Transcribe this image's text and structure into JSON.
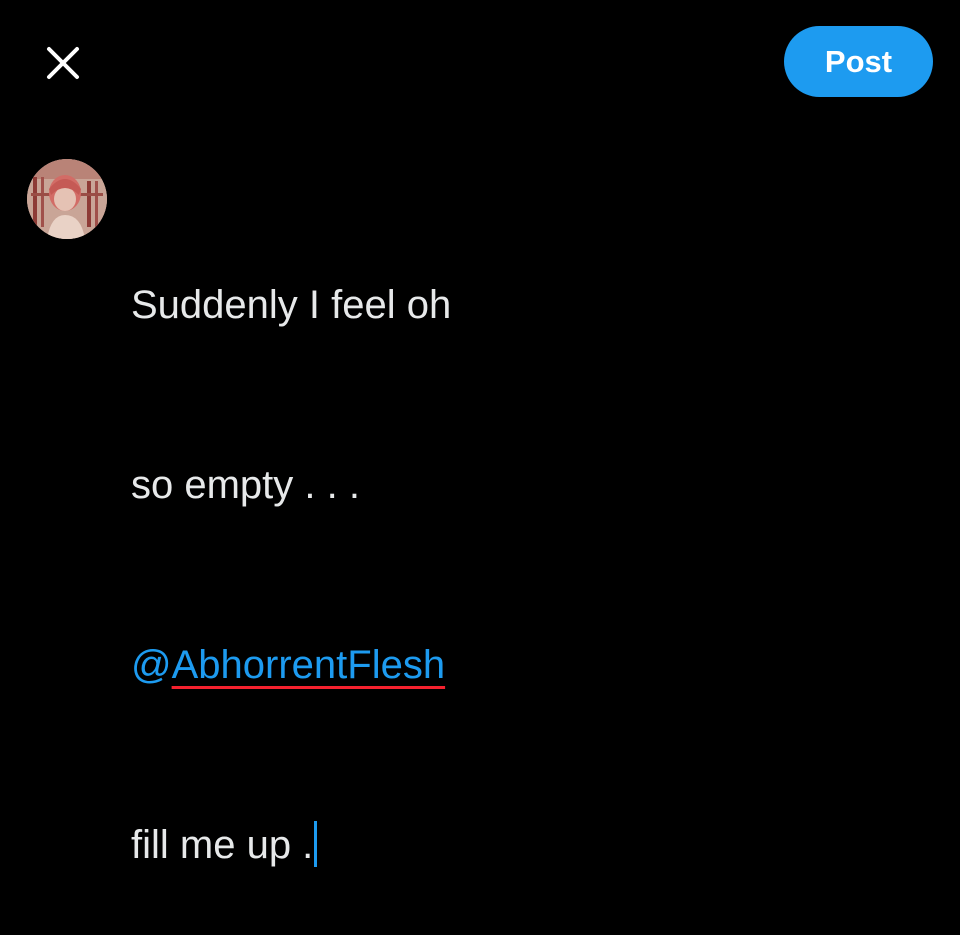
{
  "toolbar": {
    "close_icon": "close-icon",
    "post_label": "Post"
  },
  "colors": {
    "accent": "#1d9bf0",
    "background": "#000000",
    "text": "#e7e9ea",
    "spellcheck_underline": "#f4212e"
  },
  "composer": {
    "avatar": "user-avatar",
    "line1": "Suddenly I feel oh",
    "line2": "so empty . . .",
    "mention_at": "@",
    "mention_name": "AbhorrentFlesh",
    "line4": "fill me up ."
  }
}
